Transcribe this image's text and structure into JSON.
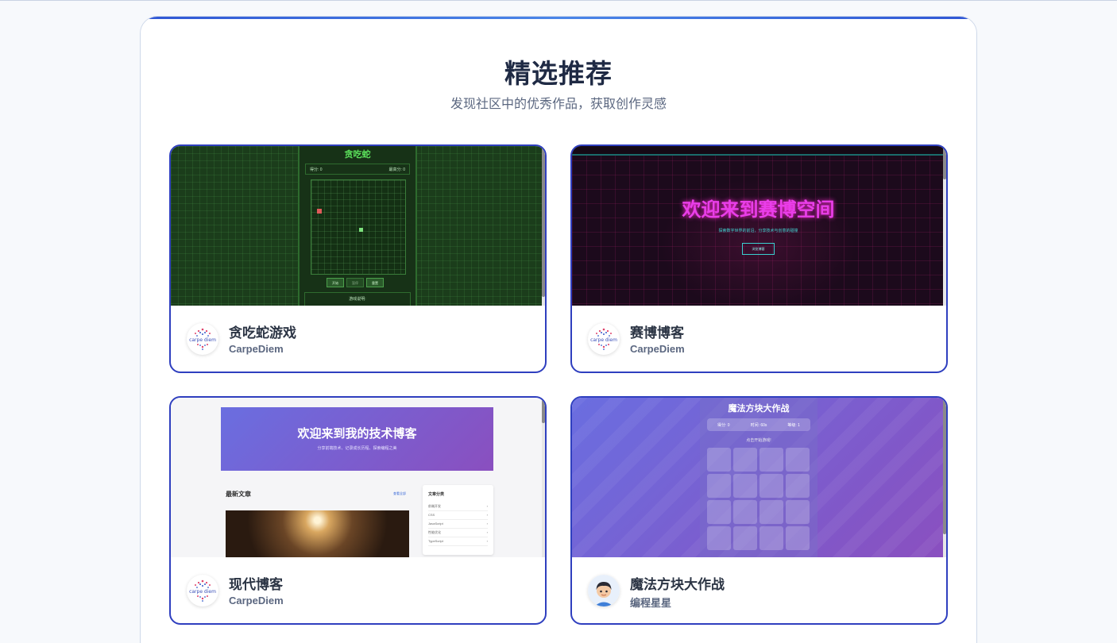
{
  "section": {
    "title": "精选推荐",
    "subtitle": "发现社区中的优秀作品，获取创作灵感"
  },
  "cards": [
    {
      "title": "贪吃蛇游戏",
      "author": "CarpeDiem",
      "avatar_icon": "carpe-diem-logo-icon",
      "preview": {
        "heading": "贪吃蛇",
        "score_label": "得分: 0",
        "best_label": "最高分: 0",
        "buttons": [
          "开始",
          "暂停",
          "重置"
        ],
        "help_label": "游戏说明:"
      }
    },
    {
      "title": "赛博博客",
      "author": "CarpeDiem",
      "avatar_icon": "carpe-diem-logo-icon",
      "preview": {
        "heading": "欢迎来到赛博空间",
        "subheading": "探索数字世界的前沿，分享技术与创意的碰撞",
        "button": "浏览博客"
      }
    },
    {
      "title": "现代博客",
      "author": "CarpeDiem",
      "avatar_icon": "carpe-diem-logo-icon",
      "preview": {
        "heading": "欢迎来到我的技术博客",
        "subheading": "分享前端技术、记录成长历程、探索编程之美",
        "latest_label": "最新文章",
        "view_all": "查看全部",
        "sidebar_title": "文章分类",
        "categories": [
          "前端开发",
          "CSS",
          "JavaScript",
          "性能优化",
          "TypeScript"
        ]
      }
    },
    {
      "title": "魔法方块大作战",
      "author": "编程星星",
      "avatar_icon": "boy-avatar-icon",
      "preview": {
        "heading": "魔法方块大作战",
        "stats": [
          "得分: 0",
          "时间: 60s",
          "等级: 1"
        ],
        "hint": "点击开始游戏!"
      }
    }
  ],
  "colors": {
    "card_border": "#2f3fbf",
    "title_text": "#1f2a44",
    "subtitle_text": "#5b6780"
  }
}
